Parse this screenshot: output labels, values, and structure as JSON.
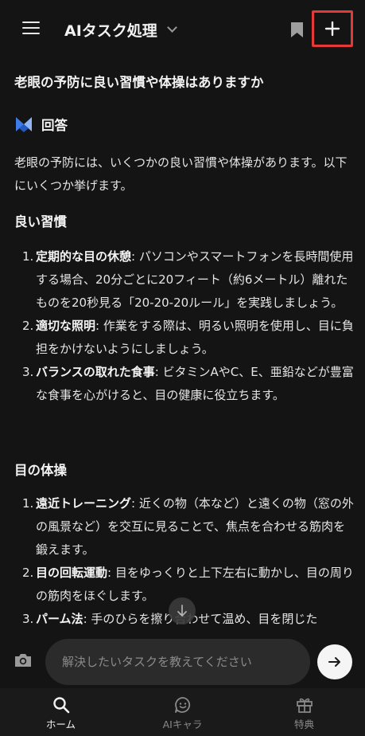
{
  "header": {
    "title": "AIタスク処理"
  },
  "question": "老眼の予防に良い習慣や体操はありますか",
  "answer": {
    "label": "回答",
    "intro": "老眼の予防には、いくつかの良い習慣や体操があります。以下にいくつか挙げます。",
    "sections": [
      {
        "title": "良い習慣",
        "items": [
          {
            "num": "1.",
            "term": "定期的な目の休憩",
            "text": ": パソコンやスマートフォンを長時間使用する場合、20分ごとに20フィート（約6メートル）離れたものを20秒見る「20-20-20ルール」を実践しましょう。"
          },
          {
            "num": "2.",
            "term": "適切な照明",
            "text": ": 作業をする際は、明るい照明を使用し、目に負担をかけないようにしましょう。"
          },
          {
            "num": "3.",
            "term": "バランスの取れた食事",
            "text": ": ビタミンAやC、E、亜鉛などが豊富な食事を心がけると、目の健康に役立ちます。"
          }
        ]
      },
      {
        "title": "目の体操",
        "items": [
          {
            "num": "1.",
            "term": "遠近トレーニング",
            "text": ": 近くの物（本など）と遠くの物（窓の外の風景など）を交互に見ることで、焦点を合わせる筋肉を鍛えます。"
          },
          {
            "num": "2.",
            "term": "目の回転運動",
            "text": ": 目をゆっくりと上下左右に動かし、目の周りの筋肉をほぐします。"
          },
          {
            "num": "3.",
            "term": "パーム法",
            "text": ": 手のひらを擦り合わせて温め、目を閉じた"
          }
        ]
      }
    ]
  },
  "input": {
    "placeholder": "解決したいタスクを教えてください"
  },
  "nav": {
    "items": [
      {
        "label": "ホーム",
        "icon": "search-icon"
      },
      {
        "label": "AIキャラ",
        "icon": "chat-smile-icon"
      },
      {
        "label": "特典",
        "icon": "gift-icon"
      }
    ]
  },
  "colors": {
    "background": "#141414",
    "highlight_border": "#e53935",
    "logo_blue": "#3d7be8"
  }
}
